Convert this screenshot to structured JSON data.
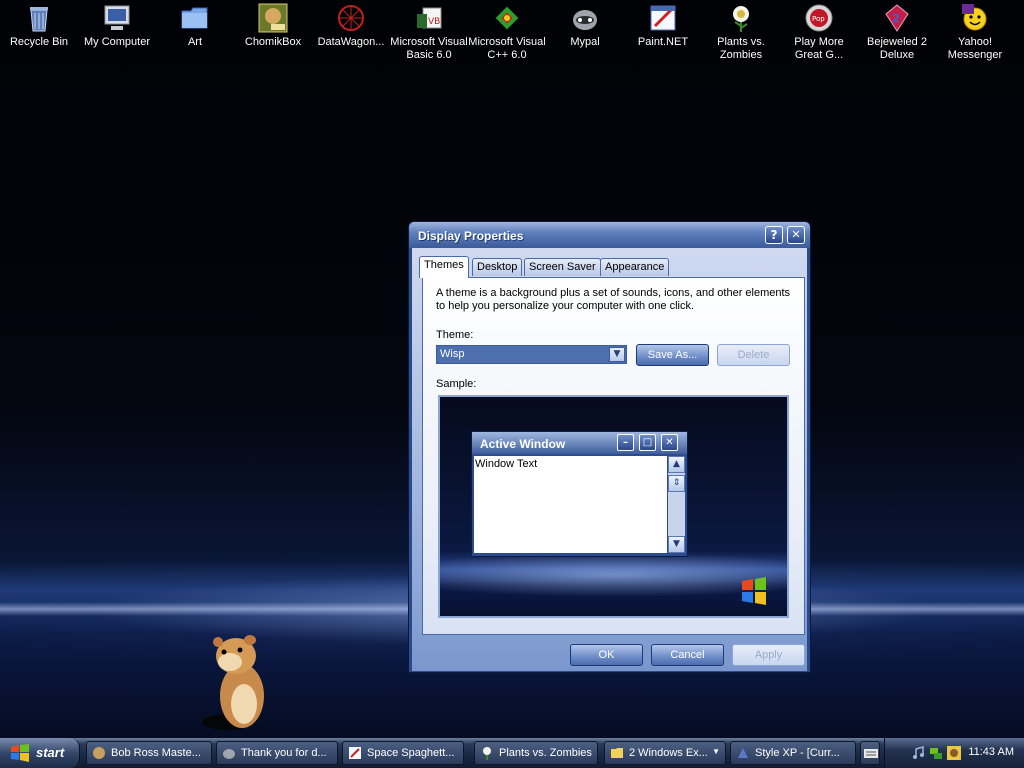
{
  "desktop": {
    "icons": [
      {
        "label": "Recycle Bin",
        "icon": "recycle-bin-icon"
      },
      {
        "label": "My Computer",
        "icon": "computer-icon"
      },
      {
        "label": "Art",
        "icon": "folder-icon"
      },
      {
        "label": "ChomikBox",
        "icon": "chomikbox-icon"
      },
      {
        "label": "DataWagon...",
        "icon": "datawagon-icon"
      },
      {
        "label": "Microsoft Visual Basic 6.0",
        "icon": "visual-basic-icon"
      },
      {
        "label": "Microsoft Visual C++ 6.0",
        "icon": "visual-cpp-icon"
      },
      {
        "label": "Mypal",
        "icon": "mypal-icon"
      },
      {
        "label": "Paint.NET",
        "icon": "paint-net-icon"
      },
      {
        "label": "Plants vs. Zombies",
        "icon": "plants-vs-zombies-icon"
      },
      {
        "label": "Play More Great G...",
        "icon": "popcap-icon"
      },
      {
        "label": "Bejeweled 2 Deluxe",
        "icon": "bejeweled-icon"
      },
      {
        "label": "Yahoo! Messenger",
        "icon": "yahoo-messenger-icon"
      }
    ]
  },
  "dialog": {
    "title": "Display Properties",
    "help_label": "?",
    "close_label": "✕",
    "tabs": [
      "Themes",
      "Desktop",
      "Screen Saver",
      "Appearance"
    ],
    "description": "A theme is a background plus a set of sounds, icons, and other elements to help you personalize your computer with one click.",
    "theme_label": "Theme:",
    "theme_value": "Wisp",
    "save_as_label": "Save As...",
    "delete_label": "Delete",
    "sample_label": "Sample:",
    "sample": {
      "window_title": "Active Window",
      "window_text": "Window Text"
    },
    "ok_label": "OK",
    "cancel_label": "Cancel",
    "apply_label": "Apply"
  },
  "taskbar": {
    "start_label": "start",
    "items": [
      {
        "label": "Bob Ross Maste...",
        "icon": "bob-ross-icon"
      },
      {
        "label": "Thank you for d...",
        "icon": "mypal-icon"
      },
      {
        "label": "Space Spaghett...",
        "icon": "paint-icon"
      },
      {
        "label": "Plants vs. Zombies",
        "icon": "plants-vs-zombies-icon"
      },
      {
        "label": "2 Windows Ex...",
        "icon": "folder-icon"
      },
      {
        "label": "Style XP - [Curr...",
        "icon": "style-xp-icon"
      }
    ],
    "clock": "11:43 AM"
  },
  "colors": {
    "accent": "#3a5a9a",
    "title_bar": "#5f80bd",
    "desktop_glow": "#1e3a78"
  }
}
